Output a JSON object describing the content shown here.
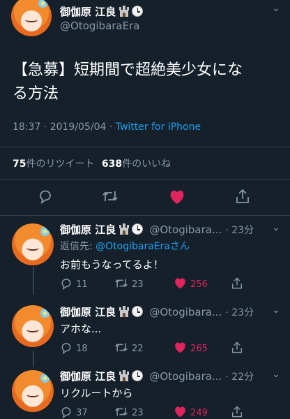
{
  "main_tweet": {
    "display_name": "御伽原 江良",
    "handle": "@OtogibaraEra",
    "text_line1": "【急募】短期間で超絶美少女にな",
    "text_line2": "る方法",
    "timestamp": "18:37 · 2019/05/04 · ",
    "client": "Twitter for iPhone",
    "retweet_count": "75",
    "retweet_label": "件のリツイート",
    "like_count": "638",
    "like_label": "件のいいね"
  },
  "replies": [
    {
      "display_name": "御伽原 江良",
      "handle": "@Otogibara...",
      "time": "· 23分",
      "reply_to_prefix": "返信先: ",
      "reply_to_handle": "@OtogibaraEra",
      "reply_to_suffix": "さん",
      "text": "お前もうなってるよ！",
      "replies": "11",
      "retweets": "23",
      "likes": "256"
    },
    {
      "display_name": "御伽原 江良",
      "handle": "@Otogibara...",
      "time": "· 23分",
      "text": "アホな...",
      "replies": "18",
      "retweets": "22",
      "likes": "265"
    },
    {
      "display_name": "御伽原 江良",
      "handle": "@Otogibara...",
      "time": "· 22分",
      "text": "リクルートから",
      "replies": "37",
      "retweets": "23",
      "likes": "249"
    }
  ],
  "colors": {
    "background": "#15202b",
    "link": "#1da1f2",
    "like": "#e0245e",
    "muted": "#8899a6"
  }
}
